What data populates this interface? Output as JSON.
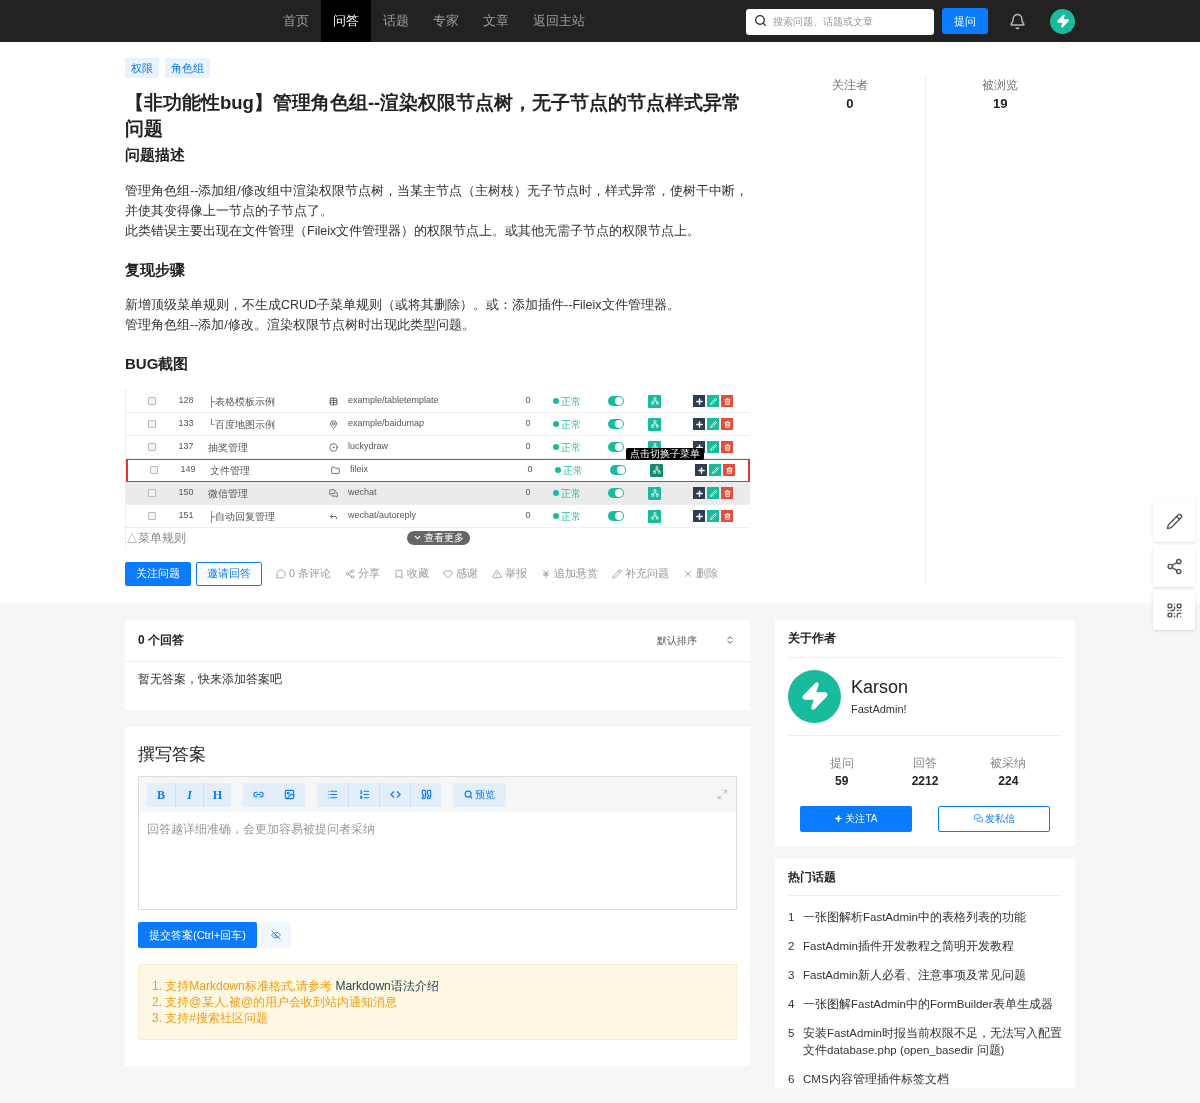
{
  "nav": {
    "items": [
      {
        "label": "首页",
        "selected": false
      },
      {
        "label": "问答",
        "selected": true
      },
      {
        "label": "话题",
        "selected": false
      },
      {
        "label": "专家",
        "selected": false
      },
      {
        "label": "文章",
        "selected": false
      },
      {
        "label": "返回主站",
        "selected": false
      }
    ],
    "search": {
      "placeholder": "搜索问题、话题或文章"
    },
    "ask_button": "提问"
  },
  "question": {
    "tags": [
      "权限",
      "角色组"
    ],
    "title": "【非功能性bug】管理角色组--渲染权限节点树，无子节点的节点样式异常问题",
    "stats": [
      {
        "label": "关注者",
        "value": "0"
      },
      {
        "label": "被浏览",
        "value": "19"
      }
    ],
    "sections": [
      {
        "heading": "问题描述",
        "paragraphs": [
          "管理角色组--添加组/修改组中渲染权限节点树，当某主节点（主树枝）无子节点时，样式异常，使树干中断，并使其变得像上一节点的子节点了。",
          "此类错误主要出现在文件管理（Fileix文件管理器）的权限节点上。或其他无需子节点的权限节点上。"
        ]
      },
      {
        "heading": "复现步骤",
        "paragraphs": [
          "新增顶级菜单规则，不生成CRUD子菜单规则（或将其删除）。或：添加插件--Fileix文件管理器。",
          "管理角色组--添加/修改。渲染权限节点树时出现此类型问题。"
        ]
      },
      {
        "heading": "BUG截图"
      }
    ],
    "screenshot": {
      "rows": [
        {
          "checked": false,
          "id": "128",
          "title": "├表格模板示例",
          "path": "example/tabletemplate",
          "weigh": "0",
          "status": "正常",
          "on": true,
          "outlined": false,
          "shaded": false
        },
        {
          "checked": false,
          "id": "133",
          "title": "└百度地图示例",
          "path": "example/baidumap",
          "weigh": "0",
          "status": "正常",
          "on": true,
          "outlined": false,
          "shaded": false
        },
        {
          "checked": false,
          "id": "137",
          "title": "抽奖管理",
          "path": "luckydraw",
          "weigh": "0",
          "status": "正常",
          "on": true,
          "outlined": false,
          "shaded": false
        },
        {
          "checked": false,
          "id": "149",
          "title": "文件管理",
          "path": "fileix",
          "weigh": "0",
          "status": "正常",
          "on": true,
          "outlined": true,
          "shaded": false,
          "tooltip": "点击切换子菜单"
        },
        {
          "checked": false,
          "id": "150",
          "title": "微信管理",
          "path": "wechat",
          "weigh": "0",
          "status": "正常",
          "on": true,
          "outlined": false,
          "shaded": true
        },
        {
          "checked": false,
          "id": "151",
          "title": "├自动回复管理",
          "path": "wechat/autoreply",
          "weigh": "0",
          "status": "正常",
          "on": true,
          "outlined": false,
          "shaded": false
        }
      ],
      "caption": "△菜单规则",
      "more_button": "查看更多"
    },
    "actions": [
      {
        "kind": "primary",
        "label": "关注问题"
      },
      {
        "kind": "outline",
        "label": "邀请回答"
      },
      {
        "kind": "link",
        "label": "0 条评论"
      },
      {
        "kind": "link",
        "label": "分享"
      },
      {
        "kind": "link",
        "label": "收藏"
      },
      {
        "kind": "link",
        "label": "感谢"
      },
      {
        "kind": "link",
        "label": "举报"
      },
      {
        "kind": "link",
        "label": "追加悬赏"
      },
      {
        "kind": "link",
        "label": "补充问题"
      },
      {
        "kind": "link",
        "label": "删除"
      }
    ]
  },
  "answers": {
    "count": "0 个回答",
    "sort": "默认排序",
    "empty": "暂无答案，快来添加答案吧"
  },
  "write": {
    "title": "撰写答案",
    "format_buttons": [
      "B",
      "I",
      "H"
    ],
    "preview_button": "预览",
    "placeholder": "回答越详细准确，会更加容易被提问者采纳",
    "submit": "提交答案(Ctrl+回车)",
    "tips": [
      {
        "number": "1.",
        "text": "支持Markdown标准格式,请参考",
        "link": "Markdown语法介绍"
      },
      {
        "number": "2.",
        "text": "支持@某人,被@的用户会收到站内通知消息"
      },
      {
        "number": "3.",
        "text": "支持#搜索社区问题"
      }
    ]
  },
  "author": {
    "heading": "关于作者",
    "name": "Karson",
    "bio": "FastAdmin!",
    "stats": [
      {
        "label": "提问",
        "value": "59"
      },
      {
        "label": "回答",
        "value": "2212"
      },
      {
        "label": "被采纳",
        "value": "224"
      }
    ],
    "follow_button": "关注TA",
    "message_button": "发私信"
  },
  "hot_topics": {
    "heading": "热门话题",
    "items": [
      {
        "number": "1",
        "title": "一张图解析FastAdmin中的表格列表的功能"
      },
      {
        "number": "2",
        "title": "FastAdmin插件开发教程之简明开发教程"
      },
      {
        "number": "3",
        "title": "FastAdmin新人必看、注意事项及常见问题"
      },
      {
        "number": "4",
        "title": "一张图解FastAdmin中的FormBuilder表单生成器"
      },
      {
        "number": "5",
        "title": "安装FastAdmin时报当前权限不足，无法写入配置文件database.php (open_basedir 问题)"
      },
      {
        "number": "6",
        "title": "CMS内容管理插件标签文档"
      }
    ]
  }
}
